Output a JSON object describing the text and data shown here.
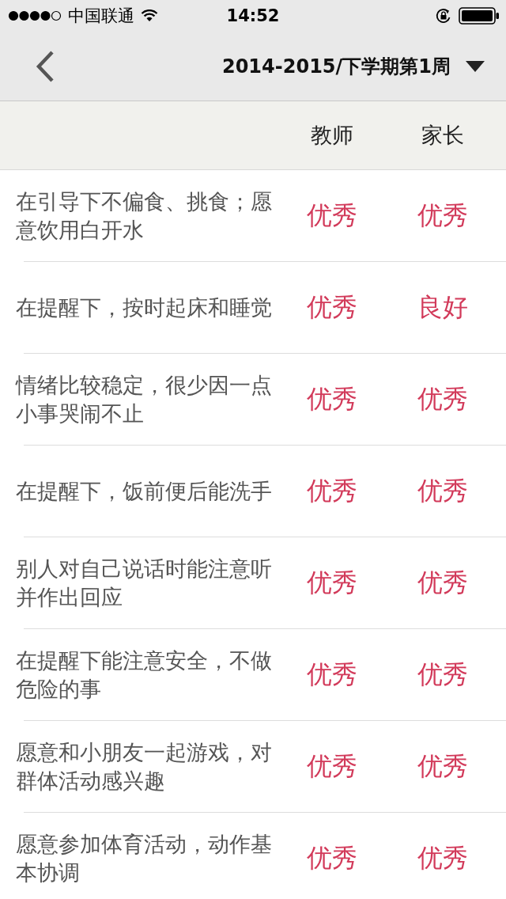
{
  "status_bar": {
    "carrier": "中国联通",
    "time": "14:52"
  },
  "nav": {
    "title": "2014-2015/下学期第1周"
  },
  "table": {
    "columns": [
      "教师",
      "家长"
    ],
    "rows": [
      {
        "item": "在引导下不偏食、挑食；愿意饮用白开水",
        "teacher": "优秀",
        "parent": "优秀"
      },
      {
        "item": "在提醒下，按时起床和睡觉",
        "teacher": "优秀",
        "parent": "良好"
      },
      {
        "item": "情绪比较稳定，很少因一点小事哭闹不止",
        "teacher": "优秀",
        "parent": "优秀"
      },
      {
        "item": "在提醒下，饭前便后能洗手",
        "teacher": "优秀",
        "parent": "优秀"
      },
      {
        "item": "别人对自己说话时能注意听并作出回应",
        "teacher": "优秀",
        "parent": "优秀"
      },
      {
        "item": "在提醒下能注意安全，不做危险的事",
        "teacher": "优秀",
        "parent": "优秀"
      },
      {
        "item": "愿意和小朋友一起游戏，对群体活动感兴趣",
        "teacher": "优秀",
        "parent": "优秀"
      },
      {
        "item": "愿意参加体育活动，动作基本协调",
        "teacher": "优秀",
        "parent": "优秀"
      }
    ]
  }
}
